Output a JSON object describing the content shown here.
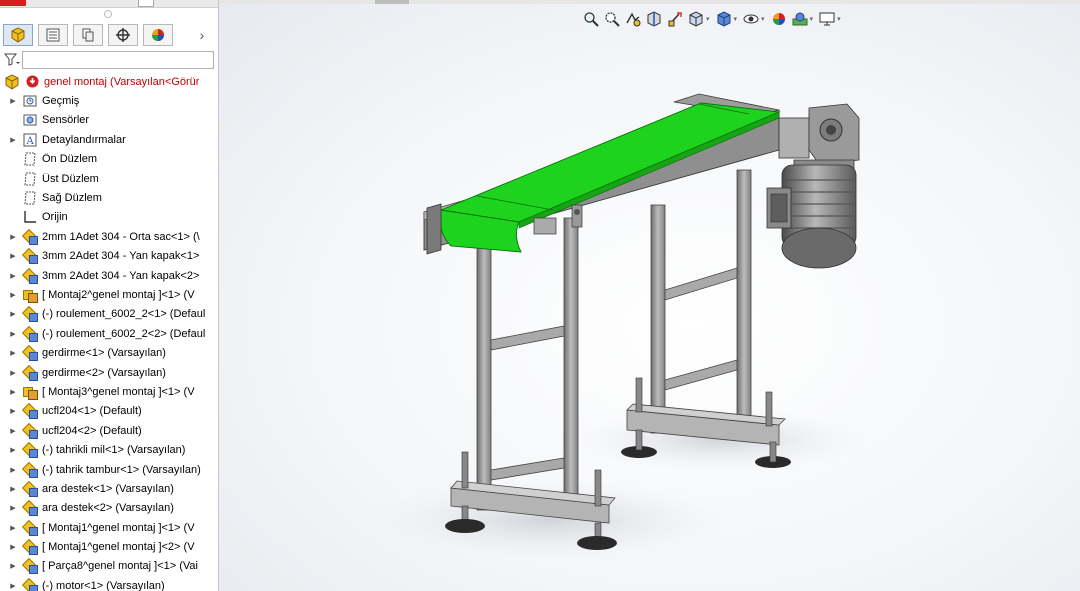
{
  "feature_manager": {
    "tabs": [
      "feature-manager-tab",
      "property-manager-tab",
      "configuration-manager-tab",
      "dimxpert-tab",
      "appearance-tab"
    ],
    "root": "genel montaj  (Varsayılan<Görür",
    "items": [
      {
        "label": "Geçmiş",
        "icon": "history-folder-icon",
        "expand": true
      },
      {
        "label": "Sensörler",
        "icon": "sensor-folder-icon",
        "expand": false
      },
      {
        "label": "Detaylandırmalar",
        "icon": "annotations-icon",
        "expand": true
      },
      {
        "label": "Ön Düzlem",
        "icon": "plane-icon",
        "expand": false
      },
      {
        "label": "Üst Düzlem",
        "icon": "plane-icon",
        "expand": false
      },
      {
        "label": "Sağ Düzlem",
        "icon": "plane-icon",
        "expand": false
      },
      {
        "label": "Orijin",
        "icon": "origin-icon",
        "expand": false
      },
      {
        "label": "2mm 1Adet 304 - Orta sac<1> (\\",
        "icon": "part-icon",
        "expand": true
      },
      {
        "label": "3mm 2Adet 304 - Yan kapak<1>",
        "icon": "part-icon",
        "expand": true
      },
      {
        "label": "3mm 2Adet 304 - Yan kapak<2>",
        "icon": "part-icon",
        "expand": true
      },
      {
        "label": "[ Montaj2^genel montaj ]<1> (V",
        "icon": "subassembly-icon",
        "expand": true
      },
      {
        "label": "(-) roulement_6002_2<1> (Defaul",
        "icon": "part-icon",
        "expand": true
      },
      {
        "label": "(-) roulement_6002_2<2> (Defaul",
        "icon": "part-icon",
        "expand": true
      },
      {
        "label": "gerdirme<1> (Varsayılan)",
        "icon": "part-icon",
        "expand": true
      },
      {
        "label": "gerdirme<2> (Varsayılan)",
        "icon": "part-icon",
        "expand": true
      },
      {
        "label": "[ Montaj3^genel montaj ]<1> (V",
        "icon": "subassembly-icon",
        "expand": true
      },
      {
        "label": "ucfl204<1> (Default)",
        "icon": "part-icon",
        "expand": true
      },
      {
        "label": "ucfl204<2> (Default)",
        "icon": "part-icon",
        "expand": true
      },
      {
        "label": "(-) tahrikli mil<1> (Varsayılan)",
        "icon": "part-icon",
        "expand": true
      },
      {
        "label": "(-) tahrik tambur<1> (Varsayılan)",
        "icon": "part-icon",
        "expand": true
      },
      {
        "label": "ara destek<1> (Varsayılan)",
        "icon": "part-icon",
        "expand": true
      },
      {
        "label": "ara destek<2> (Varsayılan)",
        "icon": "part-icon",
        "expand": true
      },
      {
        "label": "[ Montaj1^genel montaj ]<1> (V",
        "icon": "part-icon",
        "expand": true
      },
      {
        "label": "[ Montaj1^genel montaj ]<2> (V",
        "icon": "part-icon",
        "expand": true
      },
      {
        "label": "[ Parça8^genel montaj ]<1> (Vai",
        "icon": "part-icon",
        "expand": true
      },
      {
        "label": "(-) motor<1> (Varsayılan)",
        "icon": "part-icon",
        "expand": true
      }
    ]
  },
  "heads_up_toolbar": [
    "zoom-to-fit-icon",
    "zoom-to-area-icon",
    "previous-view-icon",
    "section-view-icon",
    "dynamic-annotation-icon",
    "view-orientation-icon",
    "display-style-icon",
    "hide-show-items-icon",
    "edit-appearance-icon",
    "apply-scene-icon",
    "view-settings-icon"
  ],
  "colors": {
    "belt": "#1ed31e",
    "frame": "#9a9a9a",
    "root_text": "#c00000"
  }
}
